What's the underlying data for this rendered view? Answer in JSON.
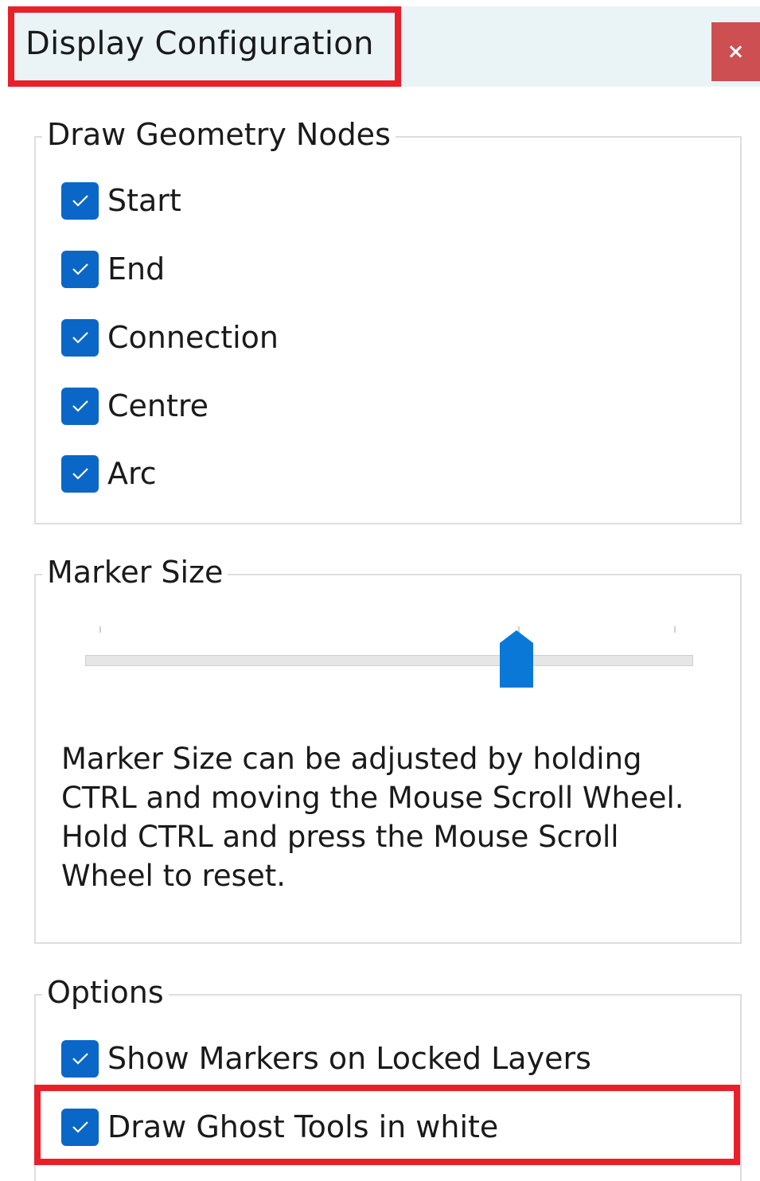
{
  "window": {
    "title": "Display Configuration",
    "close_label": "×",
    "titlebar_color": "#eaf4f7",
    "close_color": "#cd4f52",
    "highlight_color": "#e8202a"
  },
  "draw_geometry_nodes": {
    "legend": "Draw Geometry Nodes",
    "items": [
      {
        "label": "Start",
        "checked": true
      },
      {
        "label": "End",
        "checked": true
      },
      {
        "label": "Connection",
        "checked": true
      },
      {
        "label": "Centre",
        "checked": true
      },
      {
        "label": "Arc",
        "checked": true
      }
    ]
  },
  "marker_size": {
    "legend": "Marker Size",
    "slider_fraction": 0.71,
    "help_text": "Marker Size can be adjusted by holding CTRL and moving the Mouse Scroll Wheel. Hold CTRL and press the Mouse Scroll Wheel to reset."
  },
  "options": {
    "legend": "Options",
    "items": [
      {
        "label": "Show Markers on Locked Layers",
        "checked": true
      },
      {
        "label": "Draw Ghost Tools in white",
        "checked": true
      }
    ]
  },
  "colors": {
    "accent": "#0a67c7"
  }
}
